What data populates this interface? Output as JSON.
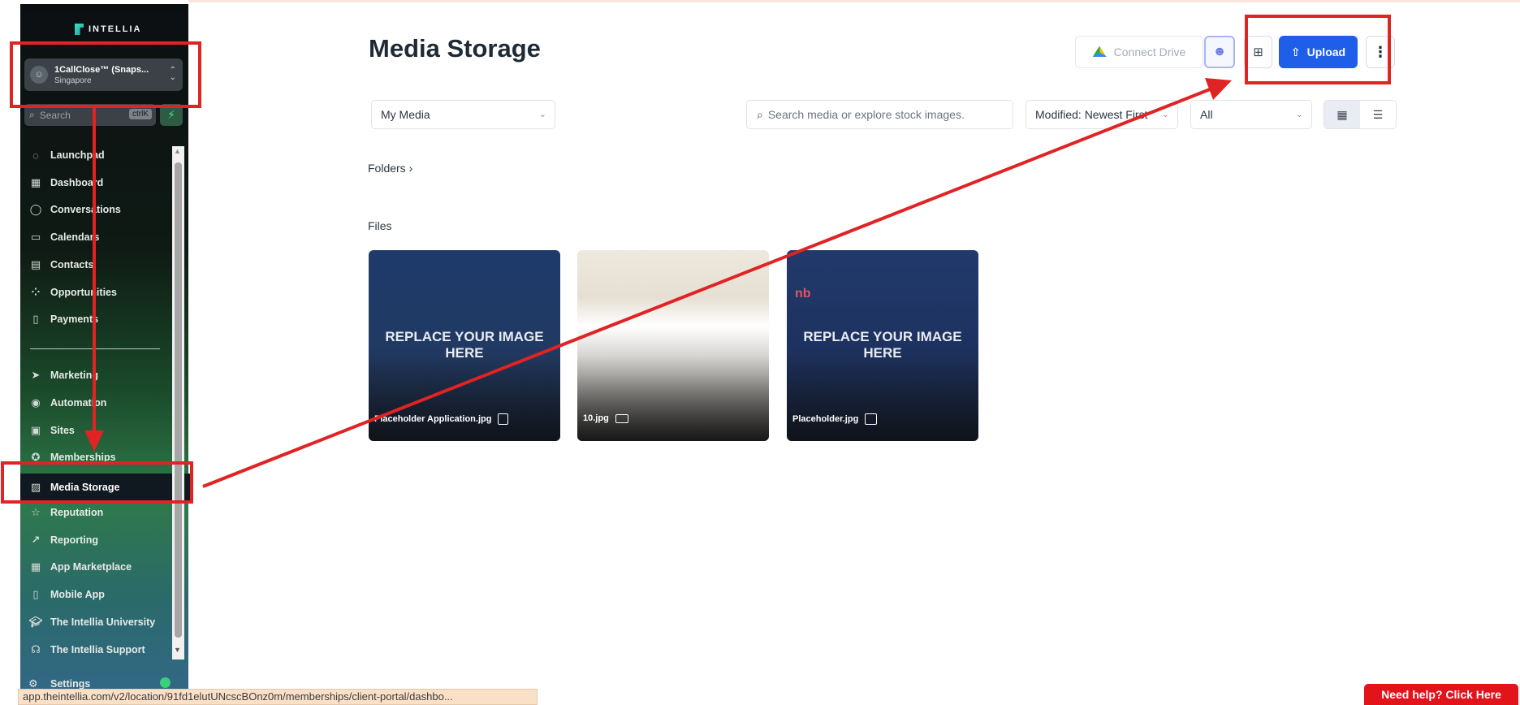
{
  "sidebar": {
    "logo": "INTELLIA",
    "account": {
      "name": "1CallClose™ (Snaps...",
      "location": "Singapore"
    },
    "search": {
      "placeholder": "Search",
      "shortcut": "ctrlK"
    },
    "items": [
      {
        "label": "Launchpad",
        "icon": "rocket-icon"
      },
      {
        "label": "Dashboard",
        "icon": "grid-icon"
      },
      {
        "label": "Conversations",
        "icon": "chat-icon"
      },
      {
        "label": "Calendars",
        "icon": "calendar-icon"
      },
      {
        "label": "Contacts",
        "icon": "contacts-icon"
      },
      {
        "label": "Opportunities",
        "icon": "pipeline-icon"
      },
      {
        "label": "Payments",
        "icon": "payment-icon"
      },
      {
        "label": "Marketing",
        "icon": "send-icon"
      },
      {
        "label": "Automation",
        "icon": "automation-icon"
      },
      {
        "label": "Sites",
        "icon": "sites-icon"
      },
      {
        "label": "Memberships",
        "icon": "badge-icon"
      },
      {
        "label": "Media Storage",
        "icon": "image-icon"
      },
      {
        "label": "Reputation",
        "icon": "star-icon"
      },
      {
        "label": "Reporting",
        "icon": "trend-icon"
      },
      {
        "label": "App Marketplace",
        "icon": "apps-icon"
      },
      {
        "label": "Mobile App",
        "icon": "phone-icon"
      },
      {
        "label": "The Intellia University",
        "icon": "graduation-icon"
      },
      {
        "label": "The Intellia Support",
        "icon": "headset-icon"
      }
    ],
    "active_item": "Media Storage",
    "settings_label": "Settings"
  },
  "header": {
    "title": "Media Storage",
    "connect_drive": "Connect Drive",
    "upload": "Upload"
  },
  "filters": {
    "source": "My Media",
    "search_placeholder": "Search media or explore stock images.",
    "sort": "Modified: Newest First",
    "type": "All"
  },
  "sections": {
    "folders": "Folders",
    "files": "Files"
  },
  "files": [
    {
      "name": "Placeholder Application.jpg",
      "overlay": "REPLACE YOUR IMAGE HERE"
    },
    {
      "name": "10.jpg",
      "overlay": ""
    },
    {
      "name": "Placeholder.jpg",
      "overlay": "REPLACE YOUR IMAGE HERE"
    }
  ],
  "status_bar_url": "app.theintellia.com/v2/location/91fd1elutUNcscBOnz0m/memberships/client-portal/dashbo...",
  "help_button": "Need help? Click Here",
  "colors": {
    "primary": "#1f5ee8",
    "annotation": "#e02323",
    "help": "#e3131b"
  }
}
